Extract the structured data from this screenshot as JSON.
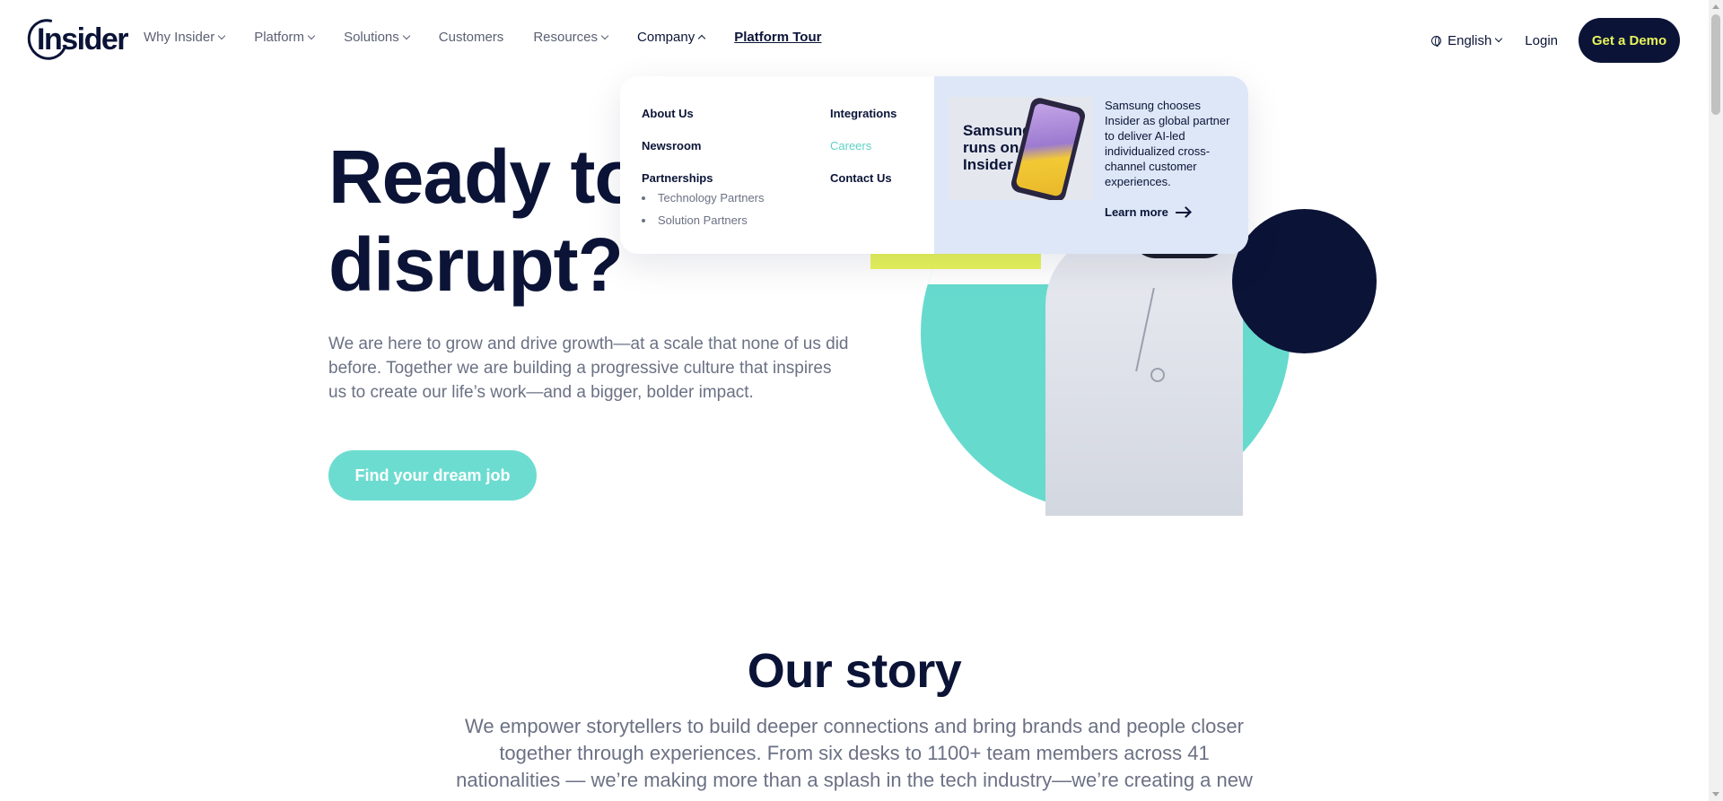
{
  "nav": {
    "logo": "Insider",
    "items": [
      {
        "label": "Why Insider",
        "has_menu": true
      },
      {
        "label": "Platform",
        "has_menu": true
      },
      {
        "label": "Solutions",
        "has_menu": true
      },
      {
        "label": "Customers",
        "has_menu": false
      },
      {
        "label": "Resources",
        "has_menu": true
      },
      {
        "label": "Company",
        "has_menu": true,
        "open": true
      },
      {
        "label": "Platform Tour",
        "has_menu": false
      }
    ],
    "language": "English",
    "login": "Login",
    "demo": "Get a Demo"
  },
  "dropdown": {
    "col1": {
      "about": "About Us",
      "newsroom": "Newsroom",
      "partnerships": "Partnerships",
      "sub": [
        "Technology Partners",
        "Solution Partners"
      ]
    },
    "col2": {
      "integrations": "Integrations",
      "careers": "Careers",
      "contact": "Contact Us"
    },
    "promo": {
      "image_text": "Samsung runs on Insider",
      "text": "Samsung chooses Insider as global partner to deliver AI-led individualized cross-channel customer experiences.",
      "link": "Learn more"
    }
  },
  "hero": {
    "title": "Ready to disrupt?",
    "description": "We are here to grow and drive growth—at a scale that none of us did before. Together we are building a progressive culture that inspires us to create our life’s work—and a bigger, bolder impact.",
    "cta": "Find your dream job"
  },
  "story": {
    "title": "Our story",
    "text": "We empower storytellers to build deeper connections and bring brands and people closer together through experiences. From six desks to 1100+ team members across 41 nationalities — we’re making more than a splash in the tech industry—we’re creating a new"
  },
  "colors": {
    "navy": "#0b1437",
    "teal": "#6ddcd0",
    "yellow": "#e8f55b",
    "promo_bg": "#dde7f7"
  }
}
